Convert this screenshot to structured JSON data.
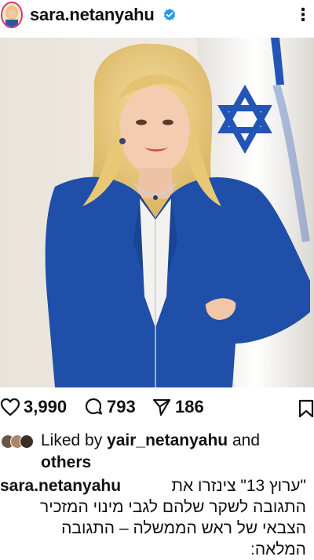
{
  "post": {
    "username": "sara.netanyahu",
    "verified_icon": "verified-badge-icon",
    "more_icon": "more-options-icon",
    "photo_subject": ""
  },
  "actions": {
    "likes": "3,990",
    "comments": "793",
    "shares": "186"
  },
  "liked_by": {
    "prefix": "Liked by",
    "user": "yair_netanyahu",
    "conjunction": "and",
    "others": "others"
  },
  "caption": {
    "username": "sara.netanyahu",
    "line1": "\"ערוץ 13\" צינזרו את",
    "line2": "התגובה לשקר שלהם לגבי מינוי המזכיר",
    "line3": "הצבאי של ראש הממשלה – התגובה",
    "line4": "המלאה:"
  },
  "colors": {
    "verified": "#1d9bf0",
    "jacket": "#1f4fa8",
    "flag_blue": "#2255b5",
    "text": "#111111"
  }
}
